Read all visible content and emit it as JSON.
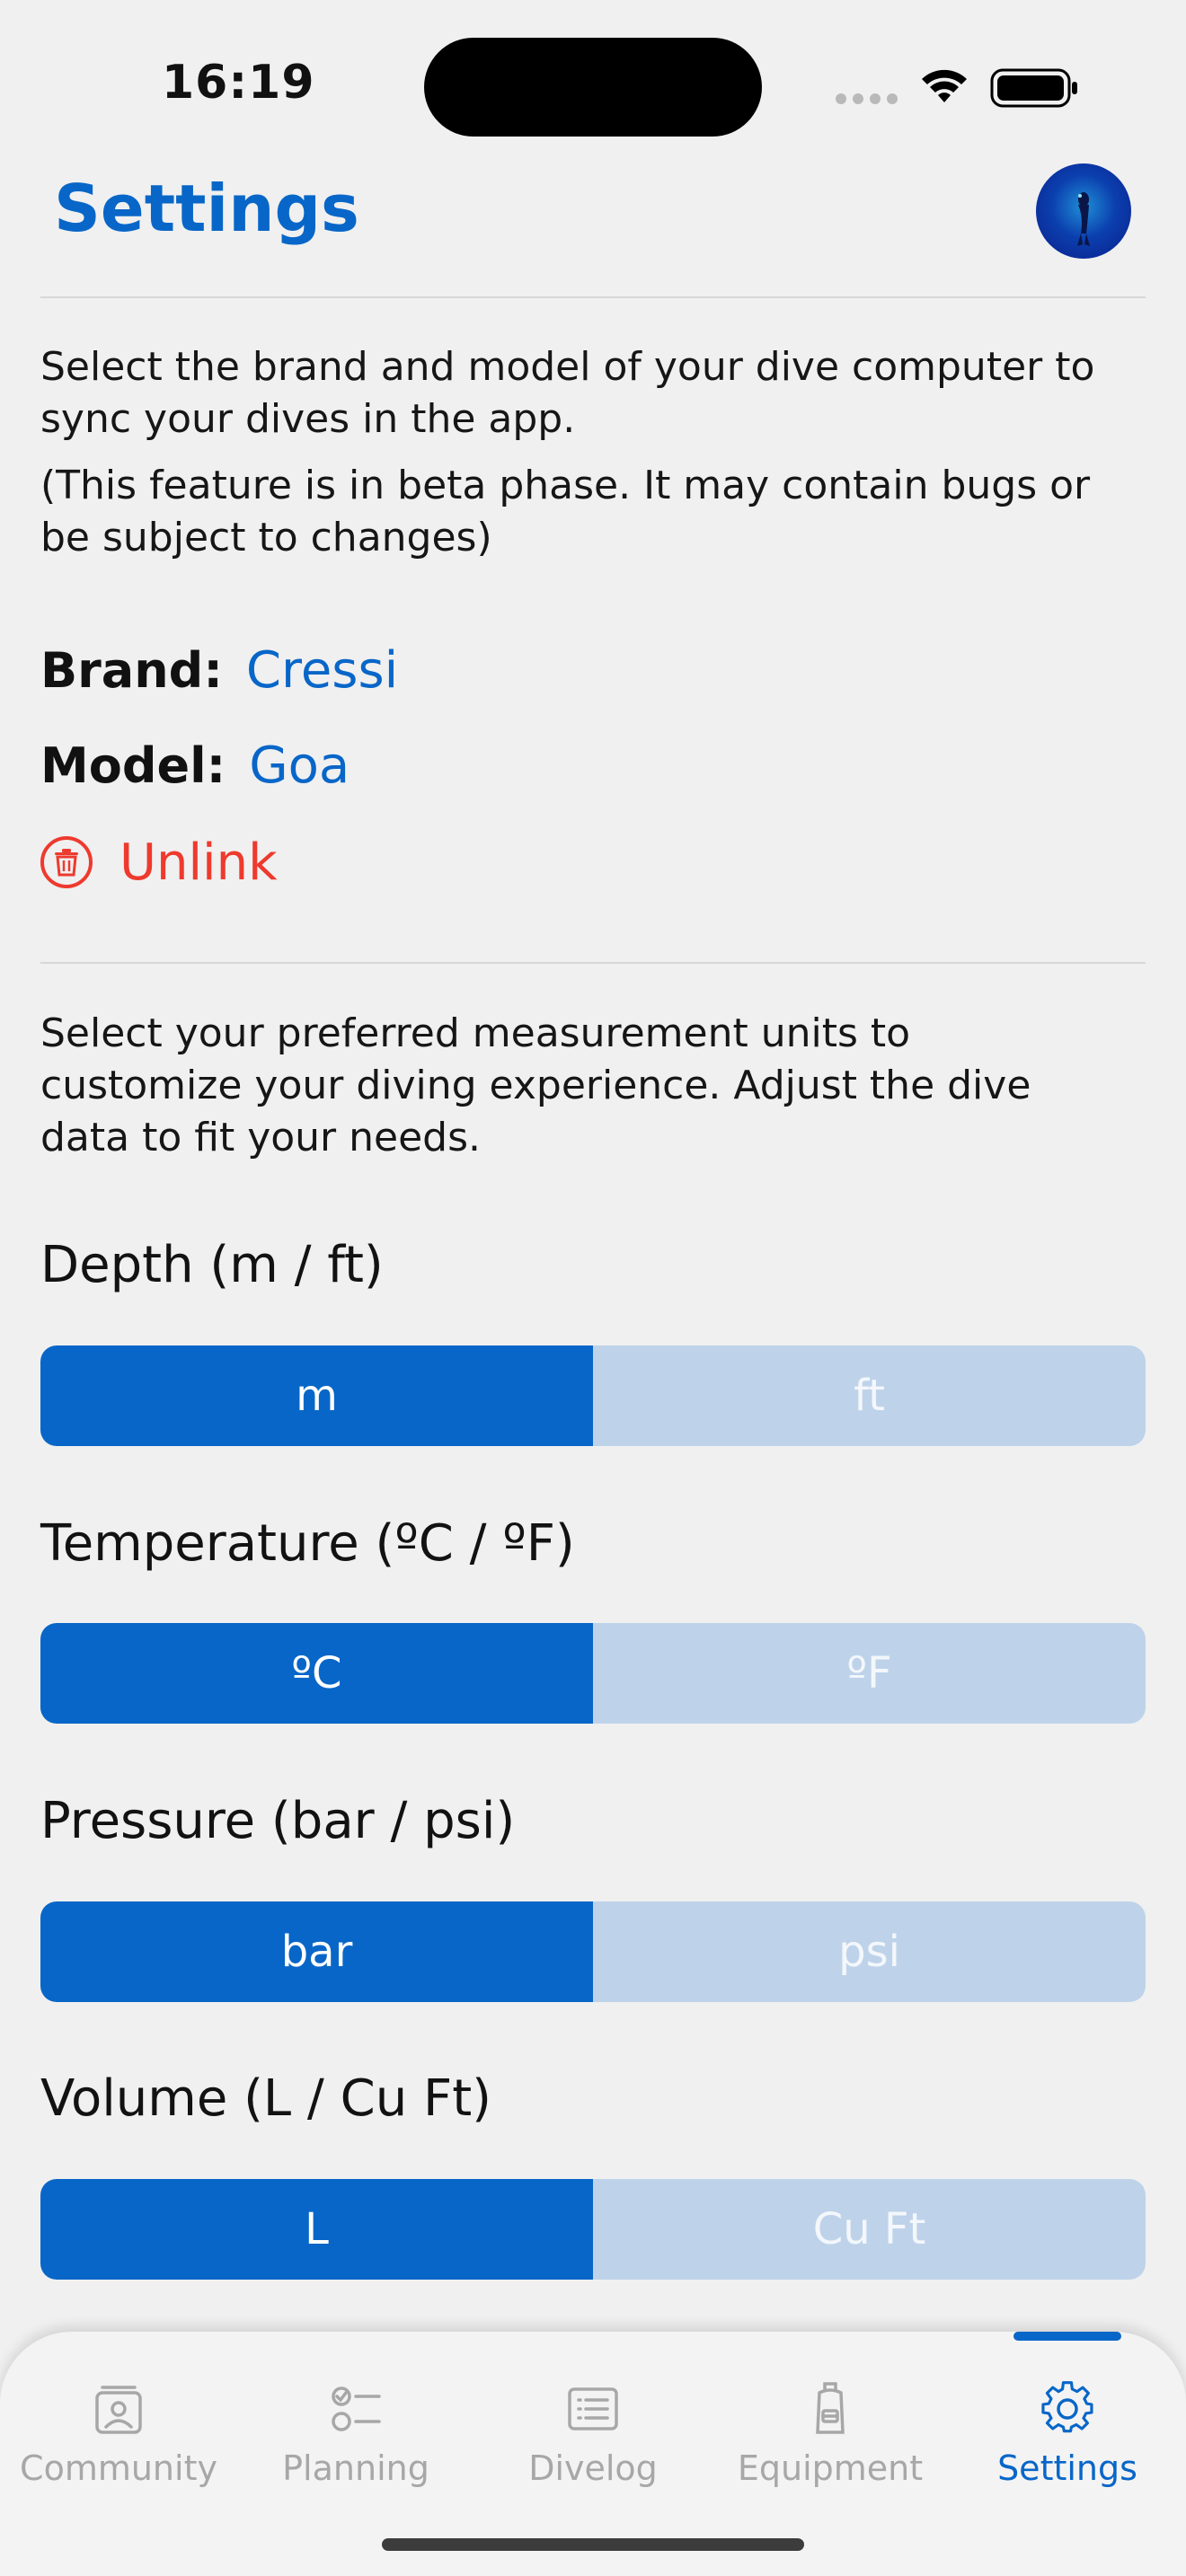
{
  "status_bar": {
    "time": "16:19"
  },
  "header": {
    "title": "Settings"
  },
  "dive_computer": {
    "intro": "Select the brand and model of your dive computer to sync your dives in the app.",
    "beta_note": "(This feature is in beta phase. It may contain bugs or be subject to changes)",
    "brand_label": "Brand:",
    "brand_value": "Cressi",
    "model_label": "Model:",
    "model_value": "Goa",
    "unlink_label": "Unlink"
  },
  "units": {
    "intro": "Select your preferred measurement units to customize your diving experience. Adjust the dive data to fit your needs.",
    "depth": {
      "label": "Depth (m / ft)",
      "options": [
        "m",
        "ft"
      ],
      "selected": "m"
    },
    "temperature": {
      "label": "Temperature (ºC / ºF)",
      "options": [
        "ºC",
        "ºF"
      ],
      "selected": "ºC"
    },
    "pressure": {
      "label": "Pressure (bar / psi)",
      "options": [
        "bar",
        "psi"
      ],
      "selected": "bar"
    },
    "volume": {
      "label": "Volume (L / Cu Ft)",
      "options": [
        "L",
        "Cu Ft"
      ],
      "selected": "L"
    }
  },
  "tabbar": {
    "tabs": [
      {
        "label": "Community",
        "icon": "community-icon"
      },
      {
        "label": "Planning",
        "icon": "planning-icon"
      },
      {
        "label": "Divelog",
        "icon": "divelog-icon"
      },
      {
        "label": "Equipment",
        "icon": "equipment-icon"
      },
      {
        "label": "Settings",
        "icon": "gear-icon"
      }
    ],
    "active": "Settings"
  },
  "colors": {
    "accent": "#0866c8",
    "danger": "#ee3a2e",
    "segment_inactive": "#bed3ea",
    "background": "#f0f0f0"
  }
}
